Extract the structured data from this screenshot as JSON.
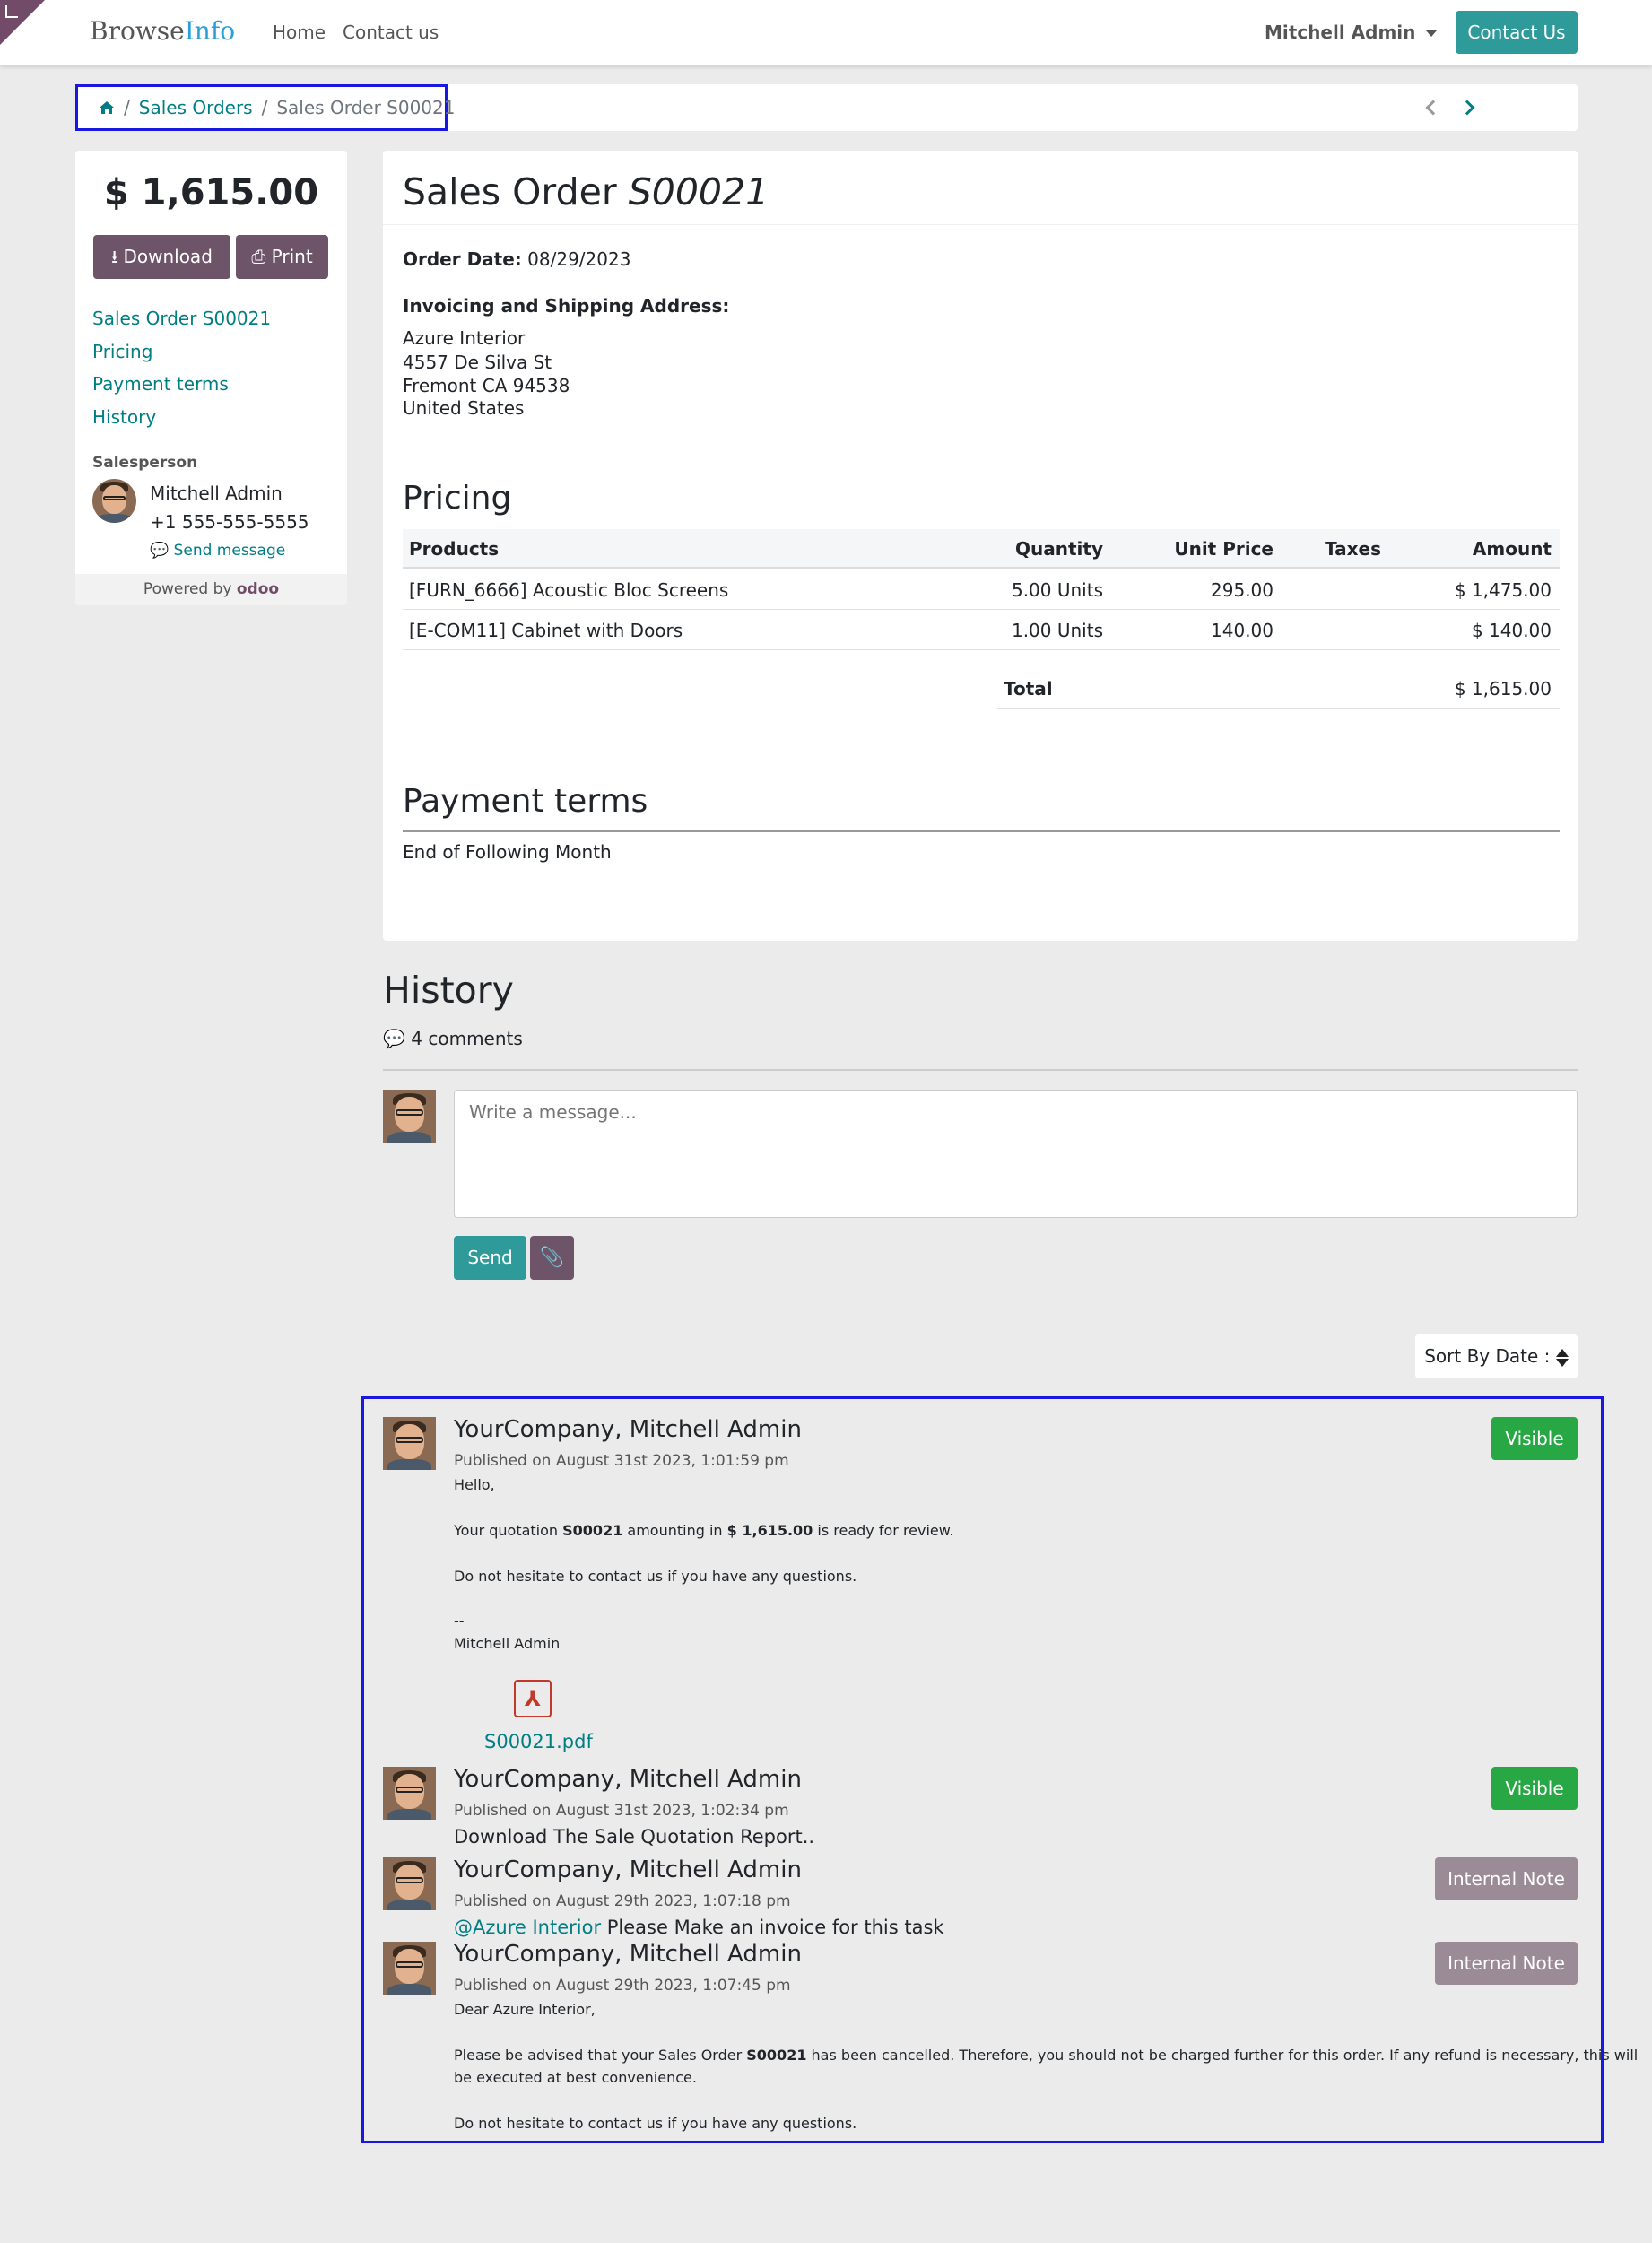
{
  "header": {
    "brand_a": "Browse",
    "brand_b": "Info",
    "nav_home": "Home",
    "nav_contact": "Contact us",
    "user": "Mitchell Admin",
    "contact_button": "Contact Us"
  },
  "breadcrumb": {
    "home_icon": "home-icon",
    "sep": "/",
    "sales_orders": "Sales Orders",
    "current": "Sales Order S00021"
  },
  "sidebar": {
    "amount": "$ 1,615.00",
    "download_label": "Download",
    "print_label": "Print",
    "links": [
      "Sales Order S00021",
      "Pricing",
      "Payment terms",
      "History"
    ],
    "salesperson_label": "Salesperson",
    "salesperson_name": "Mitchell Admin",
    "salesperson_phone": "+1 555-555-5555",
    "send_message": "Send message",
    "powered_by": "Powered by",
    "powered_brand": "odoo"
  },
  "order": {
    "title_prefix": "Sales Order",
    "title_number": "S00021",
    "order_date_label": "Order Date:",
    "order_date": "08/29/2023",
    "address_label": "Invoicing and Shipping Address:",
    "address_lines": [
      "Azure Interior",
      "4557 De Silva St",
      "Fremont CA 94538",
      "United States"
    ],
    "pricing_title": "Pricing",
    "columns": [
      "Products",
      "Quantity",
      "Unit Price",
      "Taxes",
      "Amount"
    ],
    "rows": [
      {
        "product": "[FURN_6666] Acoustic Bloc Screens",
        "qty": "5.00 Units",
        "price": "295.00",
        "taxes": "",
        "amount": "$ 1,475.00"
      },
      {
        "product": "[E-COM11] Cabinet with Doors",
        "qty": "1.00 Units",
        "price": "140.00",
        "taxes": "",
        "amount": "$ 140.00"
      }
    ],
    "total_label": "Total",
    "total_value": "$ 1,615.00",
    "payment_terms_title": "Payment terms",
    "payment_terms": "End of Following Month"
  },
  "history": {
    "title": "History",
    "comments": "4 comments",
    "message_placeholder": "Write a message...",
    "send_label": "Send",
    "sort_label": "Sort By Date :",
    "messages": [
      {
        "author": "YourCompany, Mitchell Admin",
        "published": "Published on August 31st 2023, 1:01:59 pm",
        "badge": "Visible",
        "hello": "Hello,",
        "q_a": "Your quotation ",
        "q_b": "S00021",
        "q_c": " amounting in ",
        "q_d": "$ 1,615.00",
        "q_e": " is ready for review.",
        "contact": "Do not hesitate to contact us if you have any questions.",
        "dashes": "--",
        "signature": "Mitchell Admin",
        "attachment": "S00021.pdf"
      },
      {
        "author": "YourCompany, Mitchell Admin",
        "published": "Published on August 31st 2023, 1:02:34 pm",
        "badge": "Visible",
        "text": "Download The Sale Quotation Report.."
      },
      {
        "author": "YourCompany, Mitchell Admin",
        "published": "Published on August 29th 2023, 1:07:18 pm",
        "badge": "Internal Note",
        "mention": "@Azure Interior",
        "text": " Please Make an invoice for this task"
      },
      {
        "author": "YourCompany, Mitchell Admin",
        "published": "Published on August 29th 2023, 1:07:45 pm",
        "badge": "Internal Note",
        "greeting": "Dear Azure Interior,",
        "c_a": "Please be advised that your Sales Order ",
        "c_b": "S00021",
        "c_c": " has been cancelled. Therefore, you should not be charged further for this order. If any refund is necessary, this will",
        "c_d": "be executed at best convenience.",
        "contact": "Do not hesitate to contact us if you have any questions."
      }
    ]
  }
}
